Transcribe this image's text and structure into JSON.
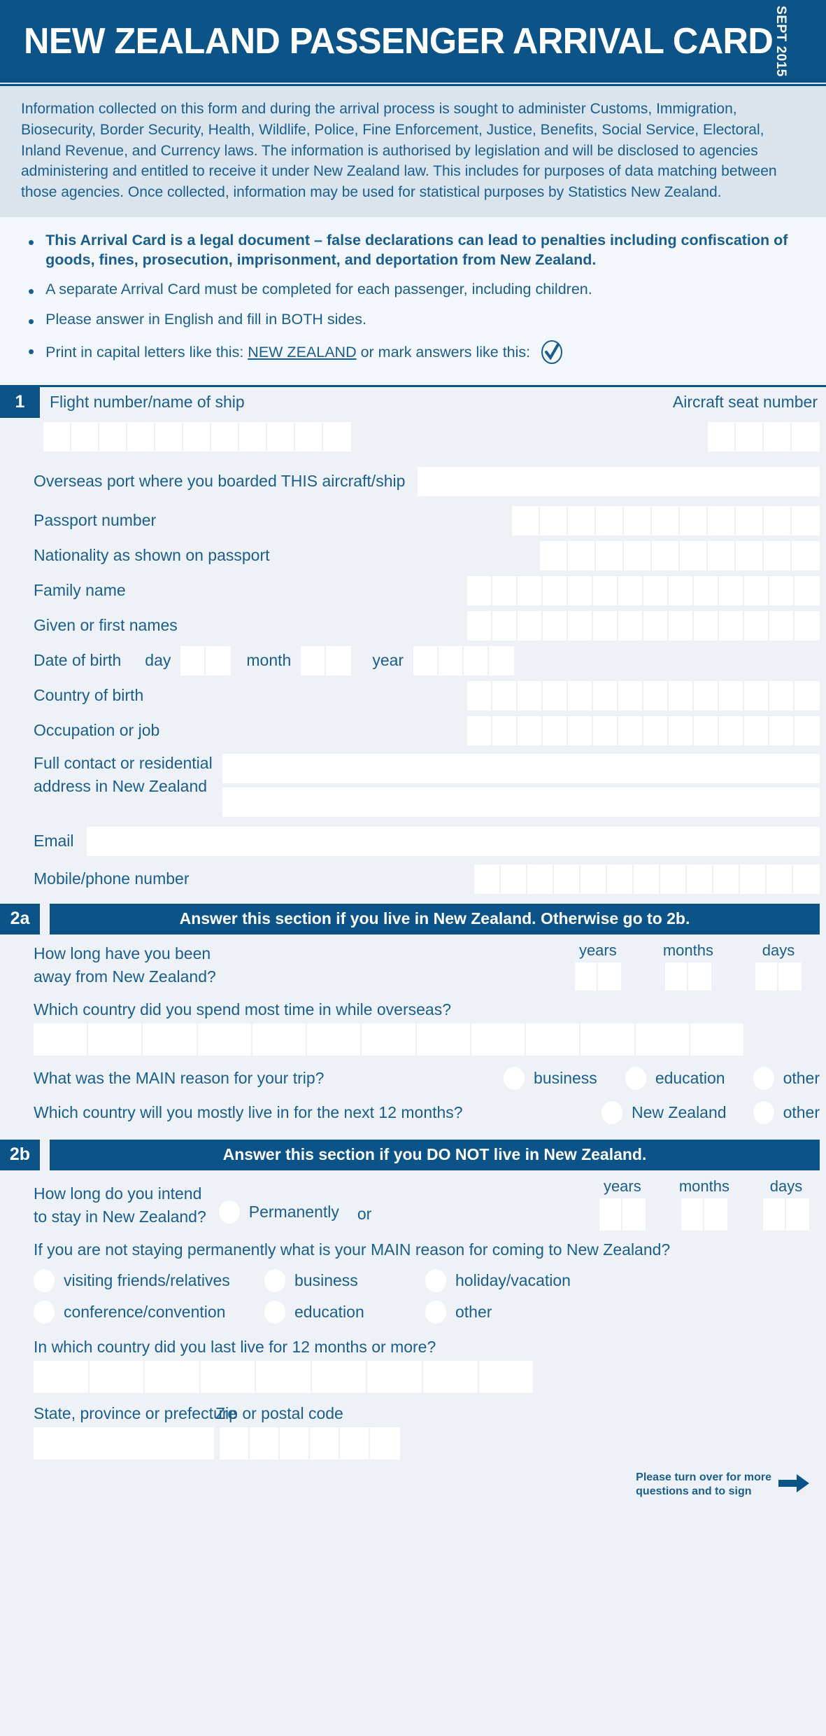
{
  "header": {
    "title": "NEW ZEALAND PASSENGER ARRIVAL CARD",
    "revision_date": "SEPT 2015",
    "bg_color": "#0c5488",
    "text_color": "#ffffff"
  },
  "info": {
    "paragraph": "Information collected on this form and during the arrival process is sought to administer Customs, Immigration, Biosecurity, Border Security, Health, Wildlife, Police, Fine Enforcement, Justice, Benefits, Social Service, Electoral, Inland Revenue, and Currency laws. The information is authorised by legislation and will be disclosed to agencies administering and entitled to receive it under New Zealand law. This includes for purposes of data matching between those agencies. Once collected, information may be used for statistical purposes by Statistics New Zealand."
  },
  "bullets": [
    {
      "text": "This Arrival Card is a legal document – false declarations can lead to penalties including confiscation of goods, fines, prosecution, imprisonment, and deportation from New Zealand.",
      "bold": true
    },
    {
      "text": "A separate Arrival Card must be completed for each passenger, including children.",
      "bold": false
    },
    {
      "text": "Please answer in English and fill in BOTH sides.",
      "bold": false
    }
  ],
  "bullet_print": {
    "prefix": "Print in capital letters like this:",
    "example": "NEW ZEALAND",
    "suffix": "or mark answers like this:",
    "tick_icon": "checkmark-icon"
  },
  "section1": {
    "number": "1",
    "flight_label": "Flight number/name of ship",
    "flight_boxes": 11,
    "seat_label": "Aircraft seat number",
    "seat_boxes": 4,
    "rows": [
      {
        "label": "Overseas port where you boarded THIS aircraft/ship",
        "type": "open"
      },
      {
        "label": "Passport number",
        "type": "boxes",
        "boxes": 11
      },
      {
        "label": "Nationality as shown on passport",
        "type": "boxes",
        "boxes": 10
      },
      {
        "label": "Family name",
        "type": "boxes",
        "boxes": 14
      },
      {
        "label": "Given or first names",
        "type": "boxes",
        "boxes": 14
      },
      {
        "label": "Country of birth",
        "type": "boxes",
        "boxes": 14
      },
      {
        "label": "Occupation or job",
        "type": "boxes",
        "boxes": 14
      }
    ],
    "dob": {
      "label": "Date of birth",
      "day_label": "day",
      "day_boxes": 2,
      "month_label": "month",
      "month_boxes": 2,
      "year_label": "year",
      "year_boxes": 4
    },
    "address": {
      "label_line1": "Full contact or residential",
      "label_line2": "address in New Zealand",
      "lines": 2
    },
    "email_label": "Email",
    "mobile_label": "Mobile/phone number",
    "mobile_boxes": 13
  },
  "section2a": {
    "number": "2a",
    "title": "Answer this section if you live in New Zealand. Otherwise go to 2b.",
    "away_question_line1": "How long have you been",
    "away_question_line2": "away from New Zealand?",
    "duration_units": [
      {
        "label": "years",
        "boxes": 2
      },
      {
        "label": "months",
        "boxes": 2
      },
      {
        "label": "days",
        "boxes": 2
      }
    ],
    "country_question": "Which country did you spend most time in while overseas?",
    "country_boxes": 13,
    "reason_question": "What was the MAIN reason for your trip?",
    "reason_options": [
      "business",
      "education",
      "other"
    ],
    "live_question": "Which country will you mostly live in for the next 12 months?",
    "live_options": [
      "New Zealand",
      "other"
    ]
  },
  "section2b": {
    "number": "2b",
    "title": "Answer this section if you DO NOT live in New Zealand.",
    "stay_question_line1": "How long do you intend",
    "stay_question_line2": "to stay in New Zealand?",
    "permanently_label": "Permanently",
    "or_label": "or",
    "duration_units": [
      {
        "label": "years",
        "boxes": 2
      },
      {
        "label": "months",
        "boxes": 2
      },
      {
        "label": "days",
        "boxes": 2
      }
    ],
    "main_reason_question": "If you are not staying permanently what is your MAIN reason for coming to New Zealand?",
    "main_reason_options_row1": [
      "visiting friends/relatives",
      "business",
      "holiday/vacation"
    ],
    "main_reason_options_row2": [
      "conference/convention",
      "education",
      "other"
    ],
    "last_live_question": "In which country did you last live for 12 months or more?",
    "last_live_boxes": 9,
    "state_label": "State, province or prefecture",
    "zip_label": "Zip or postal code",
    "zip_boxes": 6
  },
  "footer": {
    "turn_over_line1": "Please turn over for more",
    "turn_over_line2": "questions and to sign",
    "arrow_icon": "arrow-right-icon"
  },
  "colors": {
    "primary": "#0c5488",
    "text_blue": "#1a5e8e",
    "panel_bg": "#eef2f7",
    "info_bg": "#d9e4ec",
    "field_white": "#ffffff"
  }
}
